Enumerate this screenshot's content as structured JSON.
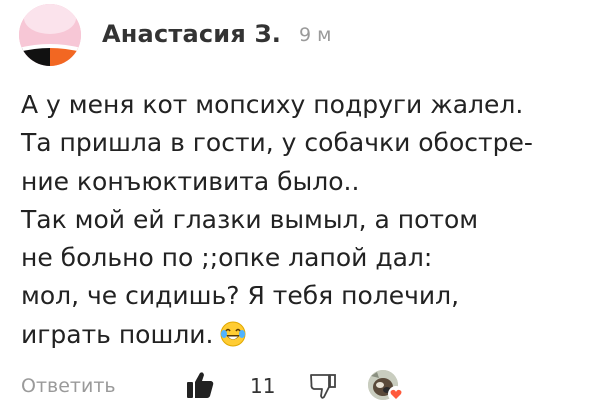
{
  "comment": {
    "author": "Анастасия З.",
    "time": "9 м",
    "lines": [
      "А у меня кот мопсиху подруги жалел.",
      "Та пришла в гости, у собачки обостре-",
      "ние  конъюктивита было..",
      "Так мой ей глазки вымыл, а  потом",
      "не больно по ;;опке лапой дал:",
      "мол, че сидишь? Я тебя полечил,",
      "играть пошли."
    ],
    "emoji": "laughing-tears-emoji"
  },
  "footer": {
    "reply_label": "Ответить",
    "like_count": "11",
    "like_icon": "thumbs-up-icon",
    "dislike_icon": "thumbs-down-icon",
    "reaction_icon": "heart-icon"
  },
  "colors": {
    "text": "#222222",
    "muted": "#9a9a9a",
    "heart": "#ff5a3c",
    "avatar_pink": "#f7c7d6",
    "avatar_orange": "#f26722"
  }
}
